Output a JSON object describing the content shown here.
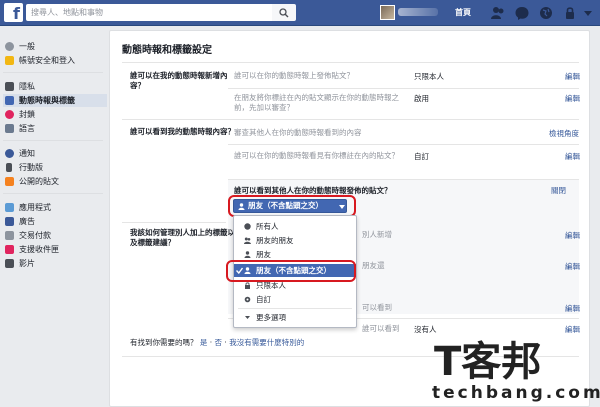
{
  "topbar": {
    "logo": "f",
    "search_placeholder": "搜尋人、地點和事物",
    "home_label": "首頁",
    "colors": {
      "bar": "#3b5998",
      "accent": "#4267b2"
    }
  },
  "sidebar": {
    "items": [
      {
        "label": "一般",
        "icon": "gear-icon"
      },
      {
        "label": "帳號安全和登入",
        "icon": "shield-icon"
      },
      {
        "label": "隱私",
        "icon": "lock-icon"
      },
      {
        "label": "動態時報與標籤",
        "icon": "timeline-icon"
      },
      {
        "label": "封鎖",
        "icon": "block-icon"
      },
      {
        "label": "語言",
        "icon": "language-icon"
      },
      {
        "label": "通知",
        "icon": "globe-icon"
      },
      {
        "label": "行動版",
        "icon": "mobile-icon"
      },
      {
        "label": "公開的貼文",
        "icon": "rss-icon"
      },
      {
        "label": "應用程式",
        "icon": "apps-icon"
      },
      {
        "label": "廣告",
        "icon": "ads-icon"
      },
      {
        "label": "交易付款",
        "icon": "payment-icon"
      },
      {
        "label": "支援收件匣",
        "icon": "support-icon"
      },
      {
        "label": "影片",
        "icon": "video-icon"
      }
    ]
  },
  "main": {
    "title": "動態時報和標籤設定",
    "sections": [
      {
        "label": "誰可以在我的動態時報新增內容？",
        "rows": [
          {
            "desc": "誰可以在你的動態時報上發佈貼文？",
            "value": "只限本人",
            "action": "編輯"
          },
          {
            "desc": "在朋友將你標註在內的貼文顯示在你的動態時報之前，先加以審查？",
            "value": "啟用",
            "action": "編輯"
          }
        ]
      },
      {
        "label": "誰可以看到我的動態時報內容？",
        "rows": [
          {
            "desc": "審查其他人在你的動態時報看到的內容",
            "value": "",
            "action": "檢視角度"
          },
          {
            "desc": "誰可以在你的動態時報看見有你標註在內的貼文？",
            "value": "自訂",
            "action": "編輯"
          }
        ],
        "expanded": {
          "question": "誰可以看到其他人在你的動態時報發佈的貼文？",
          "close": "關閉",
          "selected": "朋友（不含點頭之交）"
        }
      },
      {
        "label": "我該如何管理別人加上的標籤以及標籤建議？",
        "rows": [
          {
            "desc": "別人新增",
            "value": "",
            "action": "編輯"
          },
          {
            "desc": "朋友還",
            "value": "",
            "action": "編輯"
          },
          {
            "desc": "可以看到",
            "value": "",
            "action": "編輯"
          },
          {
            "desc": "誰可以看到",
            "value": "沒有人",
            "action": "編輯"
          }
        ]
      }
    ],
    "dropdown": {
      "options": [
        {
          "label": "所有人",
          "icon": "globe-icon"
        },
        {
          "label": "朋友的朋友",
          "icon": "friends-icon"
        },
        {
          "label": "朋友",
          "icon": "friend-icon"
        },
        {
          "label": "朋友（不含點頭之交）",
          "icon": "friend-icon",
          "selected": true
        },
        {
          "label": "只限本人",
          "icon": "lock-icon"
        },
        {
          "label": "自訂",
          "icon": "gear-icon"
        },
        {
          "label": "更多選項",
          "icon": "chevron-down-icon"
        }
      ]
    },
    "footer": {
      "question": "有找到你需要的嗎？",
      "yes": "是",
      "no": "否",
      "other": "我沒有需要什麼特別的"
    }
  },
  "watermark": {
    "big": "T客邦",
    "small": "techbang.com"
  }
}
